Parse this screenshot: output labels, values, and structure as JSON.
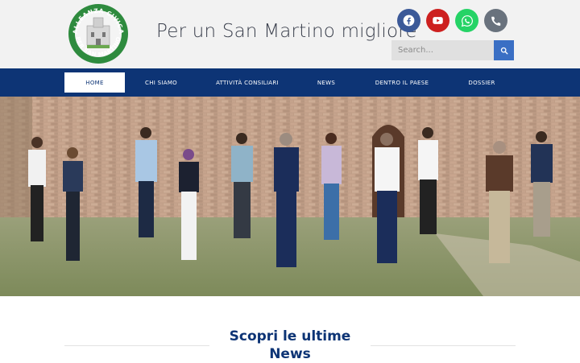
{
  "site": {
    "tagline": "Per un San Martino migliore",
    "logo": {
      "text_top": "ALLEANZA CIVICA",
      "text_bottom": "PER SAN MARTINO",
      "color": "#2e8b3e"
    }
  },
  "social": [
    {
      "name": "facebook",
      "icon": "facebook-icon",
      "color": "#3b5998"
    },
    {
      "name": "youtube",
      "icon": "youtube-icon",
      "color": "#cd201f"
    },
    {
      "name": "whatsapp",
      "icon": "whatsapp-icon",
      "color": "#25d366"
    },
    {
      "name": "phone",
      "icon": "phone-icon",
      "color": "#69727d"
    }
  ],
  "search": {
    "placeholder": "Search..."
  },
  "nav": {
    "items": [
      {
        "label": "HOME",
        "active": true
      },
      {
        "label": "CHI SIAMO"
      },
      {
        "label": "ATTIVITÀ CONSILIARI"
      },
      {
        "label": "NEWS"
      },
      {
        "label": "DENTRO IL PAESE"
      },
      {
        "label": "DOSSIER"
      }
    ]
  },
  "news_section": {
    "title": "Scopri le ultime News"
  },
  "colors": {
    "nav_bg": "#0d3475",
    "accent": "#3a6fc4",
    "header_bg": "#f2f2f2"
  }
}
